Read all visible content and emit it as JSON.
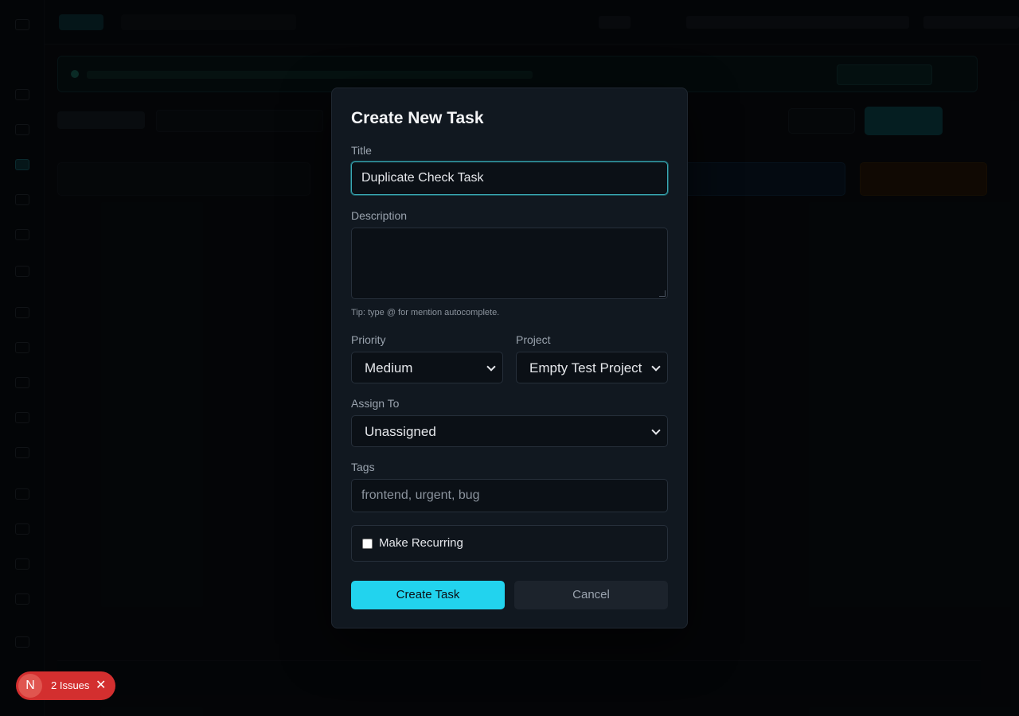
{
  "modal": {
    "title": "Create New Task",
    "title_label": "Title",
    "title_value": "Duplicate Check Task",
    "description_label": "Description",
    "description_value": "",
    "tip": "Tip: type @ for mention autocomplete.",
    "priority_label": "Priority",
    "priority_value": "Medium",
    "project_label": "Project",
    "project_value": "Empty Test Project",
    "assign_label": "Assign To",
    "assign_value": "Unassigned",
    "tags_label": "Tags",
    "tags_placeholder": "frontend, urgent, bug",
    "recurring_label": "Make Recurring",
    "recurring_checked": false,
    "create_button": "Create Task",
    "cancel_button": "Cancel"
  },
  "issues_badge": {
    "avatar_letter": "N",
    "label": "2 Issues",
    "close_glyph": "✕"
  },
  "colors": {
    "accent": "#22d3ee",
    "error_badge": "#d32f2f"
  }
}
